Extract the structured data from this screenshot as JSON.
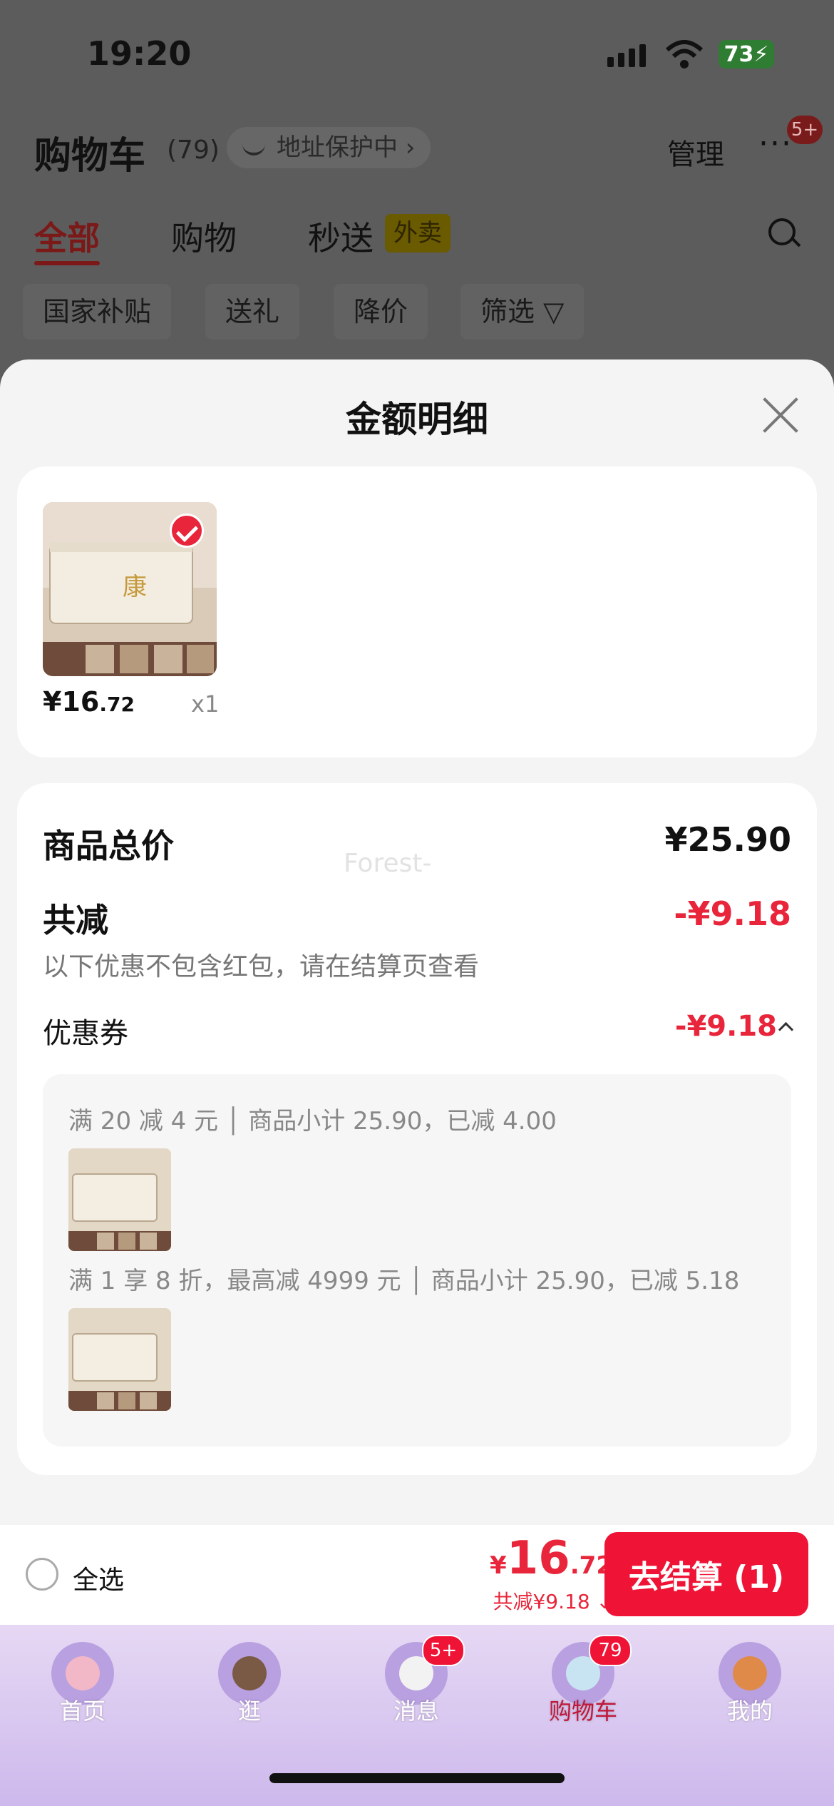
{
  "status_bar": {
    "time": "19:20",
    "battery": "73"
  },
  "header": {
    "title": "购物车",
    "count": "(79)",
    "address": "地址保护中 ›",
    "manage": "管理",
    "more": "···",
    "more_badge": "5+"
  },
  "tabs": [
    {
      "label": "全部"
    },
    {
      "label": "购物"
    },
    {
      "label": "秒送"
    }
  ],
  "waimai_tag": "外卖",
  "chips": [
    "国家补贴",
    "送礼",
    "降价",
    "筛选 ▽"
  ],
  "sheet": {
    "title": "金额明细",
    "product": {
      "price_int": "¥16",
      "price_dec": ".72",
      "qty": "x1"
    },
    "summary": {
      "total_label": "商品总价",
      "total_value": "¥25.90",
      "reduce_label": "共减",
      "reduce_value": "-¥9.18",
      "note": "以下优惠不包含红包，请在结算页查看",
      "coupon_label": "优惠券",
      "coupon_value": "-¥9.18"
    },
    "coupon_lines": [
      "满 20 减 4 元 │ 商品小计 25.90，已减 4.00",
      "满 1 享 8 折，最高减 4999 元 │ 商品小计 25.90，已减 5.18"
    ],
    "watermark": "Forest-"
  },
  "checkout": {
    "select_all": "全选",
    "currency": "¥",
    "total_int": "16",
    "total_dec": ".72",
    "saved": "共减¥9.18 ⌄",
    "pay": "去结算 (1)"
  },
  "tabbar": [
    {
      "label": "首页"
    },
    {
      "label": "逛"
    },
    {
      "label": "消息",
      "badge": "5+"
    },
    {
      "label": "购物车",
      "badge": "79"
    },
    {
      "label": "我的"
    }
  ],
  "colors": {
    "accent": "#ef1336",
    "discount": "#e8253a"
  }
}
